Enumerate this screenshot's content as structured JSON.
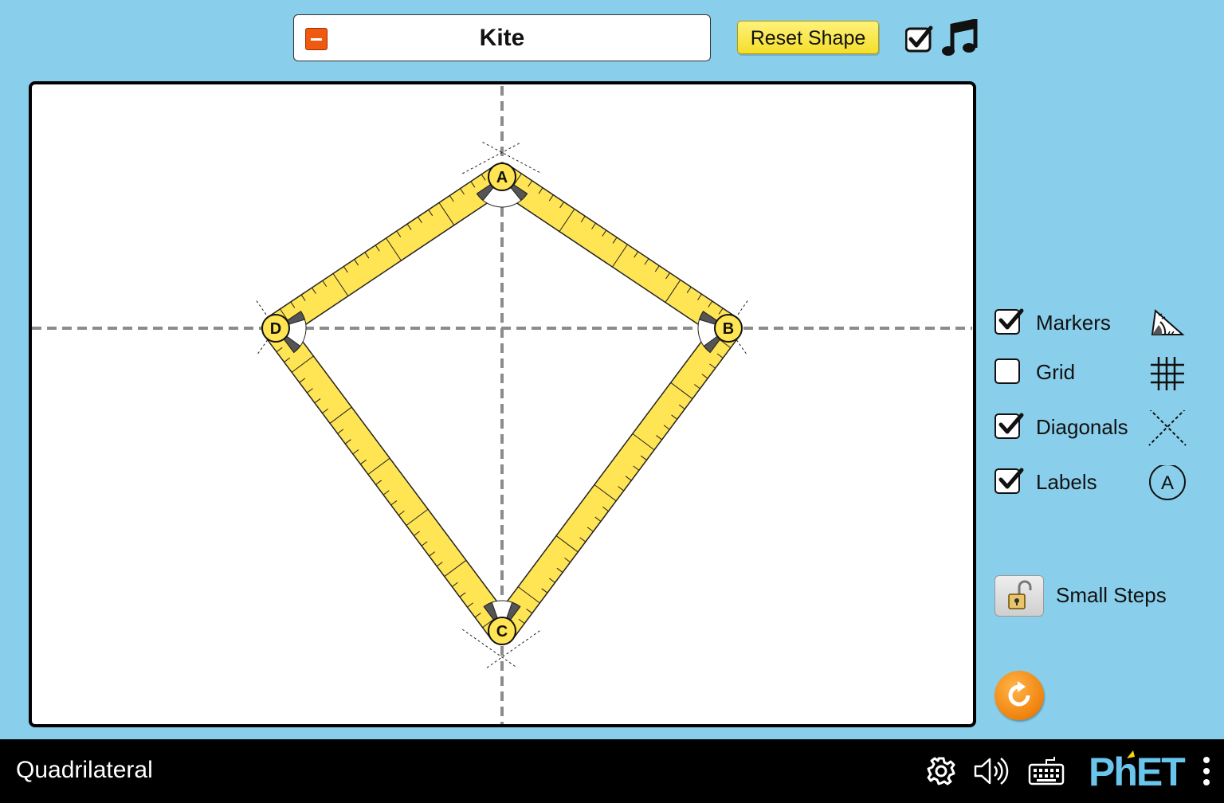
{
  "header": {
    "shape_name": "Kite",
    "reset_shape_label": "Reset Shape"
  },
  "play_area": {
    "vertices": [
      {
        "label": "A"
      },
      {
        "label": "B"
      },
      {
        "label": "C"
      },
      {
        "label": "D"
      }
    ]
  },
  "controls": {
    "items": [
      {
        "label": "Markers",
        "checked": true,
        "icon": "markers-icon"
      },
      {
        "label": "Grid",
        "checked": false,
        "icon": "grid-icon"
      },
      {
        "label": "Diagonals",
        "checked": true,
        "icon": "diagonals-icon"
      },
      {
        "label": "Labels",
        "checked": true,
        "icon": "labels-icon",
        "icon_text": "A"
      }
    ],
    "small_steps_label": "Small Steps"
  },
  "nav": {
    "title": "Quadrilateral",
    "logo_text": "PhET"
  },
  "colors": {
    "background": "#89cfeb",
    "ruler_yellow": "#ffe454",
    "vertex_fill": "#ffe454",
    "reset_orange": "#f0820c",
    "collapse_red": "#f05a10"
  }
}
